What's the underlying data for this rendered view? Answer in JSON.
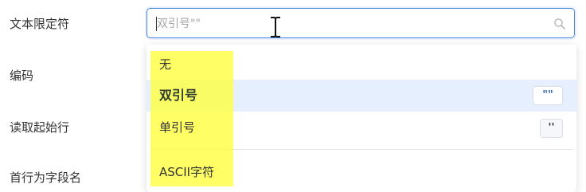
{
  "form": {
    "quote_label": "文本限定符",
    "encoding_label": "编码",
    "start_row_label": "读取起始行",
    "header_label": "首行为字段名"
  },
  "quote_select": {
    "placeholder": "双引号\"\"",
    "icon": "search-icon"
  },
  "dropdown": {
    "options": [
      {
        "label": "无",
        "badge": ""
      },
      {
        "label": "双引号",
        "badge": "\"\"",
        "selected": true
      },
      {
        "label": "单引号",
        "badge": "''"
      },
      {
        "label": "ASCII字符",
        "badge": ""
      }
    ]
  },
  "colors": {
    "accent": "#4a86e8",
    "selected_bg": "#e6effd",
    "highlight": "#ffff3a"
  }
}
